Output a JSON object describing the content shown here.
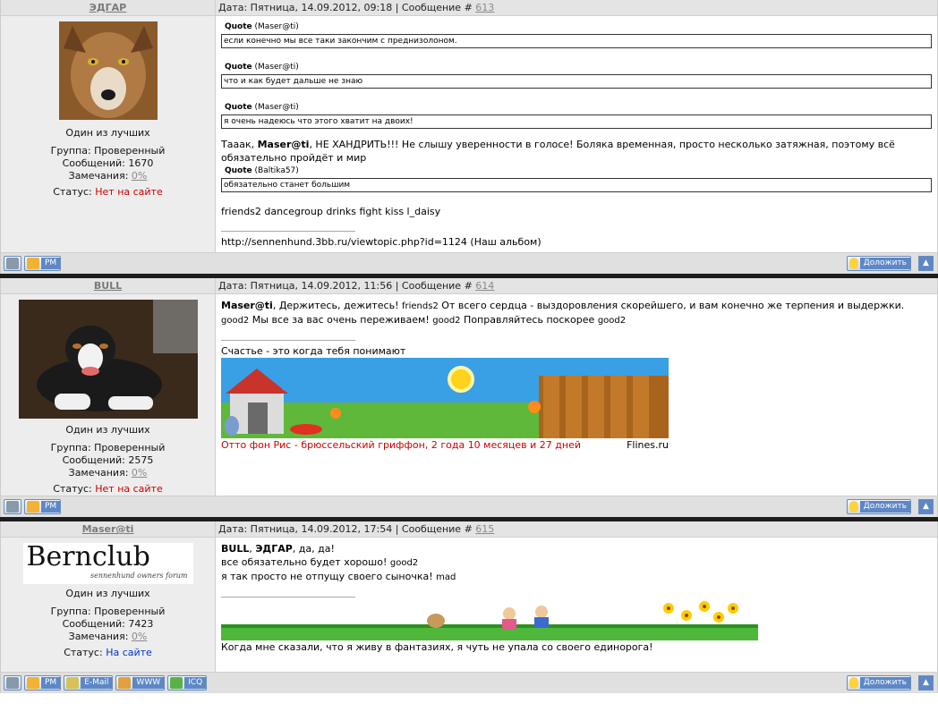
{
  "posts": [
    {
      "author": "ЭДГАР",
      "rank": "Один из лучших",
      "group": "Группа: Проверенный",
      "messages": "Сообщений: 1670",
      "warnings_label": "Замечания: ",
      "warnings_value": "0%",
      "status_label": "Статус: ",
      "status_value": "Нет на сайте",
      "date": "Дата: Пятница, 14.09.2012, 09:18 | Сообщение # ",
      "number": "613",
      "quotes": [
        {
          "label": "Quote",
          "author": "(Maser@ti)",
          "text": "если конечно мы все таки закончим с преднизолоном."
        },
        {
          "label": "Quote",
          "author": "(Maser@ti)",
          "text": "что и как будет дальше не знаю"
        },
        {
          "label": "Quote",
          "author": "(Maser@ti)",
          "text": "я очень надеюсь что этого хватит на двоих!"
        }
      ],
      "text_pre": "Тааак, ",
      "text_bold": "Maser@ti",
      "text_post": ", НЕ ХАНДРИТЬ!!! Не слышу уверенности в голосе! Боляка временная, просто несколько затяжная, поэтому всё обязательно пройдёт и мир",
      "quote4": {
        "label": "Quote",
        "author": "(Baltika57)",
        "text": "обязательно станет большим"
      },
      "smileys": "friends2 dancegroup drinks fight kiss l_daisy",
      "signature": "http://sennenhund.3bb.ru/viewtopic.php?id=1124 (Наш альбом)",
      "footer_buttons": [
        "PM"
      ],
      "complain": "Доложить"
    },
    {
      "author": "BULL",
      "rank": "Один из лучших",
      "group": "Группа: Проверенный",
      "messages": "Сообщений: 2575",
      "warnings_label": "Замечания: ",
      "warnings_value": "0%",
      "status_label": "Статус: ",
      "status_value": "Нет на сайте",
      "date": "Дата: Пятница, 14.09.2012, 11:56 | Сообщение # ",
      "number": "614",
      "text_bold": "Maser@ti",
      "text_a": ", Держитесь, дежитесь! ",
      "smiley1": "friends2",
      "text_b": " От всего сердца - выздоровления скорейшего, и вам конечно же терпения и выдержки.",
      "smiley2": "good2",
      "text_c": " Мы все за вас очень переживаем! ",
      "smiley3": "good2",
      "text_d": " Поправляйтесь поскорее ",
      "smiley4": "good2",
      "signature": "Счастье - это когда тебя понимают",
      "banner_caption_left": "Отто фон Рис - брюссельский гриффон,  2 года 10 месяцев и 27 дней",
      "banner_caption_right": "Flines.ru",
      "footer_buttons": [
        "PM"
      ],
      "complain": "Доложить"
    },
    {
      "author": "Maser@ti",
      "logo_title": "Bernclub",
      "logo_sub": "sennenhund owners forum",
      "rank": "Один из лучших",
      "group": "Группа: Проверенный",
      "messages": "Сообщений: 7423",
      "warnings_label": "Замечания: ",
      "warnings_value": "0%",
      "status_label": "Статус: ",
      "status_value": "На сайте",
      "date": "Дата: Пятница, 14.09.2012, 17:54 | Сообщение # ",
      "number": "615",
      "bold1": "BULL",
      "sep1": ", ",
      "bold2": "ЭДГАР",
      "text_a": ", да, да!",
      "line2": "все обязательно будет хорошо! ",
      "smiley1": "good2",
      "line3": "я так просто не отпущу своего сыночка! ",
      "smiley2": "mad",
      "signature": "Когда мне сказали, что я живу в фантазиях, я чуть не упала со своего единорога!",
      "footer_buttons": [
        "PM",
        "E-Mail",
        "WWW",
        "ICQ"
      ],
      "complain": "Доложить"
    }
  ],
  "colors": {
    "offline": "#cc0000",
    "online": "#0033cc",
    "header_bg": "#e4e4e4",
    "sidebar_bg": "#ededed",
    "separator": "#1d1d1d"
  }
}
